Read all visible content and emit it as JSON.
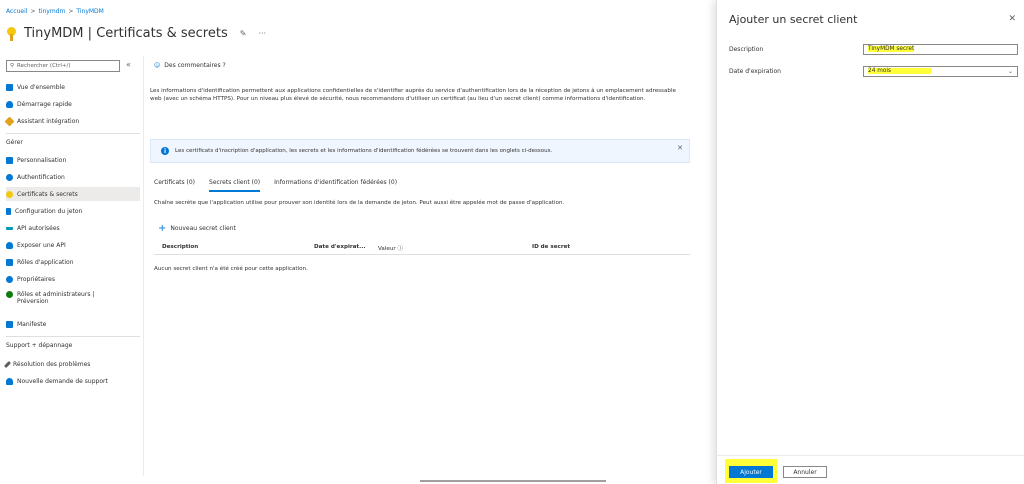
{
  "breadcrumb": [
    "Accueil",
    "tinymdm",
    "TinyMDM"
  ],
  "header": {
    "app_name": "TinyMDM",
    "separator": " | ",
    "page": "Certificats & secrets",
    "pin_icon": "pin-icon",
    "more_icon": "ellipsis-icon"
  },
  "sidebar": {
    "search_placeholder": "Rechercher (Ctrl+/)",
    "collapse": "«",
    "items_top": [
      {
        "label": "Vue d'ensemble",
        "icon": "grid-icon",
        "color": "#0078d4"
      },
      {
        "label": "Démarrage rapide",
        "icon": "cloud-icon",
        "color": "#0078d4"
      },
      {
        "label": "Assistant intégration",
        "icon": "rocket-icon",
        "color": "#e3a21a"
      }
    ],
    "section_manage": "Gérer",
    "items_manage": [
      {
        "label": "Personnalisation",
        "icon": "layout-icon",
        "color": "#0078d4"
      },
      {
        "label": "Authentification",
        "icon": "refresh-icon",
        "color": "#0078d4"
      },
      {
        "label": "Certificats & secrets",
        "icon": "key-icon",
        "color": "#f2c811"
      },
      {
        "label": "Configuration du jeton",
        "icon": "bars-icon",
        "color": "#0078d4"
      },
      {
        "label": "API autorisées",
        "icon": "arrows-icon",
        "color": "#0099bc"
      },
      {
        "label": "Exposer une API",
        "icon": "cloud-icon",
        "color": "#0078d4"
      },
      {
        "label": "Rôles d'application",
        "icon": "grid-icon",
        "color": "#0078d4"
      },
      {
        "label": "Propriétaires",
        "icon": "users-icon",
        "color": "#0078d4"
      },
      {
        "label": "Rôles et administrateurs | Préversion",
        "icon": "admin-icon",
        "color": "#107c10"
      },
      {
        "label": "Manifeste",
        "icon": "doc-icon",
        "color": "#0078d4"
      }
    ],
    "section_support": "Support + dépannage",
    "items_support": [
      {
        "label": "Résolution des problèmes",
        "icon": "wrench-icon",
        "color": "#605e5c"
      },
      {
        "label": "Nouvelle demande de support",
        "icon": "person-icon",
        "color": "#0078d4"
      }
    ]
  },
  "main": {
    "feedback": "Des commentaires ?",
    "intro": "Les informations d'identification permettent aux applications confidentielles de s'identifier auprès du service d'authentification lors de la réception de jetons à un emplacement adressable web (avec un schéma HTTPS). Pour un niveau plus élevé de sécurité, nous recommandons d'utiliser un certificat (au lieu d'un secret client) comme informations d'identification.",
    "info": "Les certificats d'inscription d'application, les secrets et les informations d'identification fédérées se trouvent dans les onglets ci-dessous.",
    "tabs": [
      {
        "label": "Certificats (0)"
      },
      {
        "label": "Secrets client (0)"
      },
      {
        "label": "Informations d'identification fédérées (0)"
      }
    ],
    "tab_desc": "Chaîne secrète que l'application utilise pour prouver son identité lors de la demande de jeton. Peut aussi être appelée mot de passe d'application.",
    "new_secret": "Nouveau secret client",
    "columns": [
      "Description",
      "Date d'expirat...",
      "Valeur ⓘ",
      "ID de secret"
    ],
    "empty": "Aucun secret client n'a été créé pour cette application."
  },
  "panel": {
    "title": "Ajouter un secret client",
    "close": "✕",
    "description_label": "Description",
    "description_value": "TinyMDM secret",
    "expiry_label": "Date d'expiration",
    "expiry_value": "24 mois",
    "add_label": "Ajouter",
    "cancel_label": "Annuler"
  },
  "colors": {
    "accent": "#0078d4",
    "highlight": "#ffff3a"
  }
}
